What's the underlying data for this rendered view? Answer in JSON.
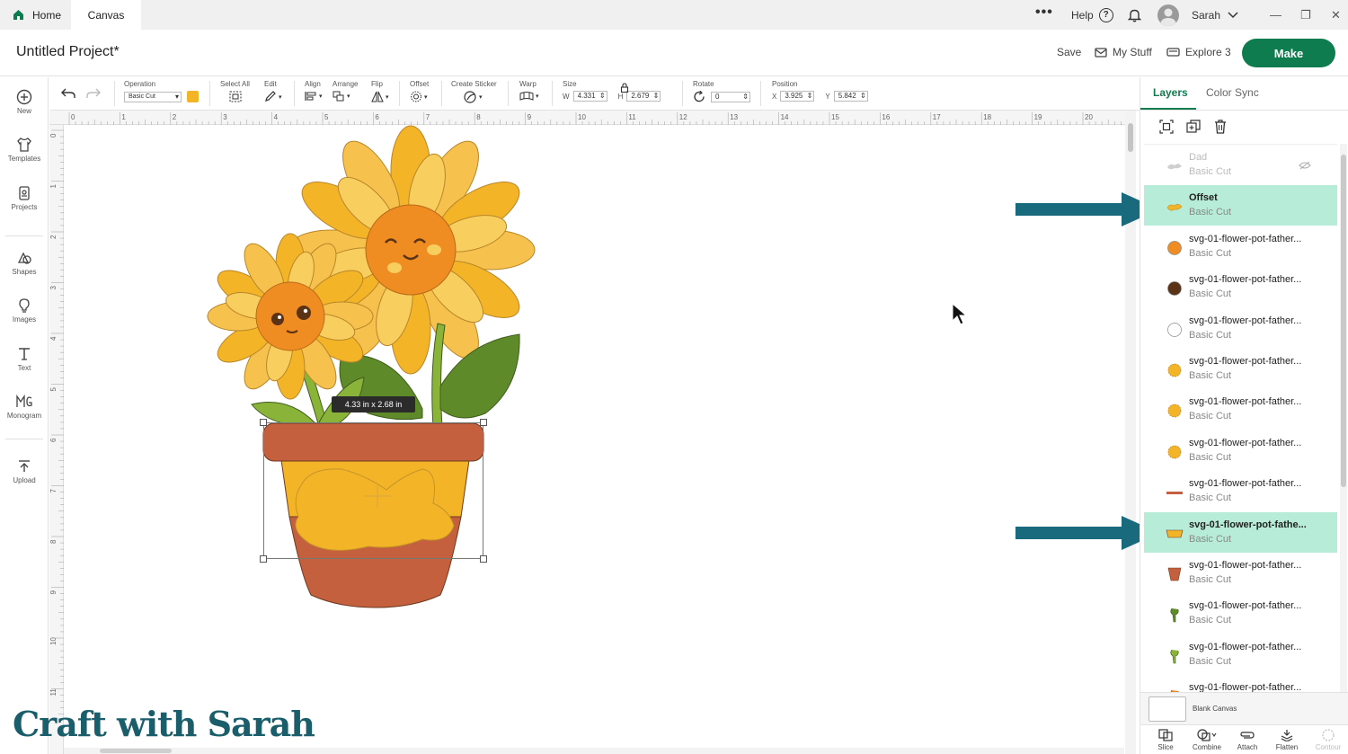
{
  "titlebar": {
    "tabs": [
      {
        "label": "Home"
      },
      {
        "label": "Canvas"
      }
    ],
    "more": "•••",
    "help_label": "Help",
    "help_glyph": "?",
    "user_name": "Sarah",
    "window_controls": [
      "—",
      "❐",
      "✕"
    ]
  },
  "header": {
    "project_title": "Untitled Project*",
    "save_label": "Save",
    "my_stuff_label": "My Stuff",
    "machine_label": "Explore 3",
    "make_label": "Make"
  },
  "toolbar": {
    "operation_label": "Operation",
    "operation_value": "Basic Cut",
    "operation_color": "#f4b428",
    "select_all_label": "Select All",
    "edit_label": "Edit",
    "align_label": "Align",
    "arrange_label": "Arrange",
    "flip_label": "Flip",
    "offset_label": "Offset",
    "create_sticker_label": "Create Sticker",
    "warp_label": "Warp",
    "size_label": "Size",
    "w_label": "W",
    "w_value": "4.331",
    "h_label": "H",
    "h_value": "2.679",
    "rotate_label": "Rotate",
    "rotate_value": "0",
    "position_label": "Position",
    "x_label": "X",
    "x_value": "3.925",
    "y_label": "Y",
    "y_value": "5.842"
  },
  "leftbar": {
    "items": [
      {
        "label": "New"
      },
      {
        "label": "Templates"
      },
      {
        "label": "Projects"
      },
      {
        "label": "Shapes"
      },
      {
        "label": "Images"
      },
      {
        "label": "Text"
      },
      {
        "label": "Monogram"
      },
      {
        "label": "Upload"
      }
    ]
  },
  "canvas": {
    "ruler_h": [
      "0",
      "1",
      "2",
      "3",
      "4",
      "5",
      "6",
      "7",
      "8",
      "9",
      "10",
      "11",
      "12",
      "13",
      "14",
      "15",
      "16",
      "17",
      "18",
      "19",
      "20"
    ],
    "ruler_v": [
      "0",
      "1",
      "2",
      "3",
      "4",
      "5",
      "6",
      "7",
      "8",
      "9",
      "10",
      "11"
    ],
    "dimension_label": "4.33  in x 2.68  in"
  },
  "watermark": "Craft with Sarah",
  "panel": {
    "tabs": [
      {
        "label": "Layers"
      },
      {
        "label": "Color Sync"
      }
    ],
    "layers": [
      {
        "name": "Dad",
        "op": "Basic Cut",
        "icon": "hidden-layer-icon"
      },
      {
        "name": "Offset",
        "op": "Basic Cut",
        "color": "#f4b428"
      },
      {
        "name": "svg-01-flower-pot-father...",
        "op": "Basic Cut",
        "color": "#ef8c22"
      },
      {
        "name": "svg-01-flower-pot-father...",
        "op": "Basic Cut",
        "color": "#5a3216"
      },
      {
        "name": "svg-01-flower-pot-father...",
        "op": "Basic Cut",
        "color": "#ffffff"
      },
      {
        "name": "svg-01-flower-pot-father...",
        "op": "Basic Cut",
        "color": "#f4b428"
      },
      {
        "name": "svg-01-flower-pot-father...",
        "op": "Basic Cut",
        "color": "#f4b428"
      },
      {
        "name": "svg-01-flower-pot-father...",
        "op": "Basic Cut",
        "color": "#f4b428"
      },
      {
        "name": "svg-01-flower-pot-father...",
        "op": "Basic Cut",
        "color": "#c4603e"
      },
      {
        "name": "svg-01-flower-pot-fathe...",
        "op": "Basic Cut",
        "color": "#f4b428"
      },
      {
        "name": "svg-01-flower-pot-father...",
        "op": "Basic Cut",
        "color": "#c4603e"
      },
      {
        "name": "svg-01-flower-pot-father...",
        "op": "Basic Cut",
        "color": "#5f8a2a"
      },
      {
        "name": "svg-01-flower-pot-father...",
        "op": "Basic Cut",
        "color": "#8ab33a"
      },
      {
        "name": "svg-01-flower-pot-father...",
        "op": "Basic Cut",
        "color": "#ef8c22"
      }
    ],
    "blank_canvas_label": "Blank Canvas",
    "bottom_tools": [
      {
        "label": "Slice"
      },
      {
        "label": "Combine"
      },
      {
        "label": "Attach"
      },
      {
        "label": "Flatten"
      },
      {
        "label": "Contour"
      }
    ]
  },
  "colors": {
    "accent": "#0f7c4f",
    "highlight": "#b7ecd8",
    "arrow": "#1a6a7d"
  }
}
